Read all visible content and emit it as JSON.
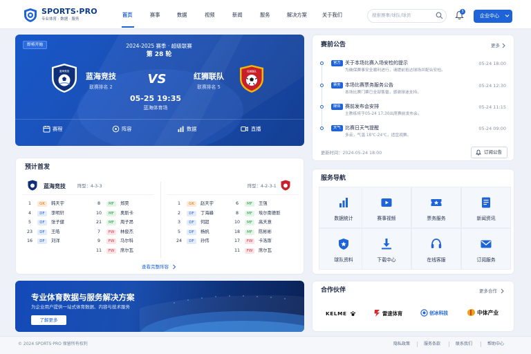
{
  "header": {
    "brand": "SPORTS·PRO",
    "slogan": "专业体育 · 数据 · 服务",
    "nav": [
      "首页",
      "赛事",
      "数据",
      "视频",
      "新闻",
      "服务",
      "解决方案",
      "关于我们"
    ],
    "active_nav": "首页",
    "search_placeholder": "搜索赛事/球队/球员",
    "notification_count": "3",
    "enterprise_button": "企业中心"
  },
  "hero": {
    "tag": "即将开始",
    "season": "2024-2025 赛季 · 超级联赛",
    "round": "第 28 轮",
    "home": {
      "name": "蓝海竞技",
      "rank": "联赛排名 2",
      "crest_text": "蓝海竞技"
    },
    "vs": "VS",
    "away": {
      "name": "红狮联队",
      "rank": "联赛排名 5",
      "crest_text": "红狮联队"
    },
    "time": "05-25 19:35",
    "venue": "蓝海体育场",
    "links": [
      "赛程",
      "阵容",
      "数据",
      "直播"
    ]
  },
  "notices": {
    "title": "赛前公告",
    "more": "更多",
    "items": [
      {
        "tag": "官方",
        "title": "关于本场比赛入场安检的提示",
        "sub": "为确保赛事安全顺利进行，请提前抵达球场并配合安检。",
        "date": "05-24 18:00"
      },
      {
        "tag": "票务",
        "title": "本场比赛票务服务公告",
        "sub": "本场比赛门票已全部售罄，感谢球迷支持。",
        "date": "05-24 12:30"
      },
      {
        "tag": "媒体",
        "title": "赛前发布会安排",
        "sub": "主教练将于05-24 17:30出席赛前发布会。",
        "date": "05-24 11:15"
      },
      {
        "tag": "天气",
        "title": "比赛日天气提醒",
        "sub": "多云，气温 18℃-24℃，适宜观赛。",
        "date": "05-24 09:00"
      }
    ],
    "updated": "更新时间：2024-05-24 18:00",
    "subscribe": "订阅公告"
  },
  "lineup": {
    "title": "预计首发",
    "home": {
      "name": "蓝海竞技",
      "formation": "阵型：4-3-3"
    },
    "away": {
      "formation": "阵型：4-2-3-1"
    },
    "home_col1": [
      {
        "num": "1",
        "pos": "GK",
        "name": "韩天宇"
      },
      {
        "num": "4",
        "pos": "DF",
        "name": "李明轩"
      },
      {
        "num": "5",
        "pos": "DF",
        "name": "张子健"
      },
      {
        "num": "23",
        "pos": "DF",
        "name": "王皓"
      },
      {
        "num": "16",
        "pos": "DF",
        "name": "刘洋"
      }
    ],
    "home_col2": [
      {
        "num": "8",
        "pos": "MF",
        "name": "郑昊"
      },
      {
        "num": "10",
        "pos": "MF",
        "name": "奥斯卡"
      },
      {
        "num": "21",
        "pos": "MF",
        "name": "周子昂"
      },
      {
        "num": "7",
        "pos": "FW",
        "name": "林俊杰"
      },
      {
        "num": "9",
        "pos": "FW",
        "name": "马尔科"
      },
      {
        "num": "11",
        "pos": "FW",
        "name": "席尔瓦"
      }
    ],
    "away_col1": [
      {
        "num": "1",
        "pos": "GK",
        "name": "赵天宇"
      },
      {
        "num": "2",
        "pos": "DF",
        "name": "丁海峰"
      },
      {
        "num": "3",
        "pos": "DF",
        "name": "何超"
      },
      {
        "num": "5",
        "pos": "DF",
        "name": "杨帆"
      },
      {
        "num": "24",
        "pos": "DF",
        "name": "孙伟"
      }
    ],
    "away_col2": [
      {
        "num": "6",
        "pos": "MF",
        "name": "王强"
      },
      {
        "num": "8",
        "pos": "MF",
        "name": "埃尔南德斯"
      },
      {
        "num": "10",
        "pos": "MF",
        "name": "高天意"
      },
      {
        "num": "18",
        "pos": "MF",
        "name": "陈彬彬"
      },
      {
        "num": "17",
        "pos": "FW",
        "name": "卡洛斯"
      },
      {
        "num": "11",
        "pos": "FW",
        "name": "席尔瓦"
      }
    ],
    "more": "查看完整阵容"
  },
  "services": {
    "title": "服务导航",
    "items": [
      "数据统计",
      "赛事视频",
      "票务服务",
      "新闻资讯",
      "球队资料",
      "下载中心",
      "在线客服",
      "订阅服务"
    ]
  },
  "banner": {
    "title": "专业体育数据与服务解决方案",
    "subtitle": "为企业用户提供一站式体育数据、内容与技术服务",
    "button": "了解更多"
  },
  "partners": {
    "title": "合作伙伴",
    "more": "更多合作",
    "logos": [
      "KELME",
      "雷速体育",
      "创冰科技",
      "中体产业"
    ]
  },
  "footer": {
    "copyright": "© 2024 SPORTS·PRO 保留所有权利",
    "links": [
      "隐私政策",
      "服务条款",
      "联系我们",
      "帮助中心"
    ]
  },
  "colors": {
    "accent": "#1e63d8",
    "hero_dark": "#133e92",
    "away_red": "#c8202b"
  }
}
